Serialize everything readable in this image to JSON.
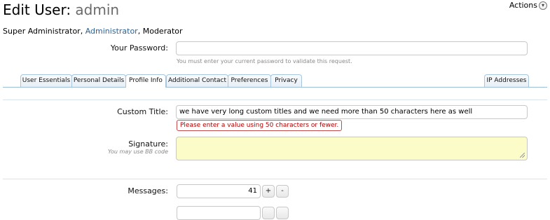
{
  "header": {
    "title_prefix": "Edit User:",
    "title_name": "admin",
    "actions_label": "Actions"
  },
  "roles": {
    "items": [
      "Super Administrator",
      "Administrator",
      "Moderator"
    ],
    "separator": ", "
  },
  "password": {
    "label": "Your Password:",
    "value": "",
    "explain": "You must enter your current password to validate this request."
  },
  "tabs": [
    {
      "label": "User Essentials",
      "active": false
    },
    {
      "label": "Personal Details",
      "active": false
    },
    {
      "label": "Profile Info",
      "active": true
    },
    {
      "label": "Additional Contact",
      "active": false
    },
    {
      "label": "Preferences",
      "active": false
    },
    {
      "label": "Privacy",
      "active": false
    },
    {
      "label": "IP Addresses",
      "active": false
    }
  ],
  "custom_title": {
    "label": "Custom Title:",
    "value": "we have very long custom titles and we need more than 50 characters here as well",
    "error": "Please enter a value using 50 characters or fewer."
  },
  "signature": {
    "label": "Signature:",
    "hint": "You may use BB code",
    "value": ""
  },
  "messages": {
    "label": "Messages:",
    "value": "41",
    "increment": "+",
    "decrement": "-"
  },
  "colors": {
    "link": "#2f5f8f",
    "error": "#b30000",
    "signature_bg": "#fcfcc8",
    "tab_border": "#a9c6dc"
  }
}
